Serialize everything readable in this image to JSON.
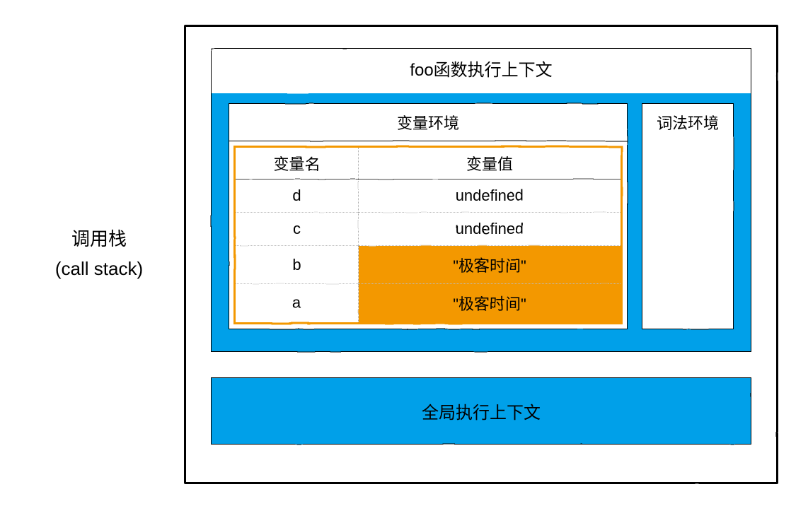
{
  "leftLabel": {
    "line1": "调用栈",
    "line2": "(call stack)"
  },
  "fooContext": {
    "title": "foo函数执行上下文",
    "varEnv": {
      "title": "变量环境",
      "colName": "变量名",
      "colValue": "变量值",
      "rows": [
        {
          "name": "d",
          "value": "undefined",
          "highlight": false
        },
        {
          "name": "c",
          "value": "undefined",
          "highlight": false
        },
        {
          "name": "b",
          "value": "\"极客时间\"",
          "highlight": true
        },
        {
          "name": "a",
          "value": "\"极客时间\"",
          "highlight": true
        }
      ]
    },
    "lexEnv": {
      "title": "词法环境"
    }
  },
  "globalContext": {
    "title": "全局执行上下文"
  },
  "chart_data": {
    "type": "table",
    "title": "foo函数执行上下文 — 变量环境",
    "columns": [
      "变量名",
      "变量值"
    ],
    "rows": [
      [
        "d",
        "undefined"
      ],
      [
        "c",
        "undefined"
      ],
      [
        "b",
        "\"极客时间\""
      ],
      [
        "a",
        "\"极客时间\""
      ]
    ],
    "highlighted_rows": [
      2,
      3
    ]
  }
}
